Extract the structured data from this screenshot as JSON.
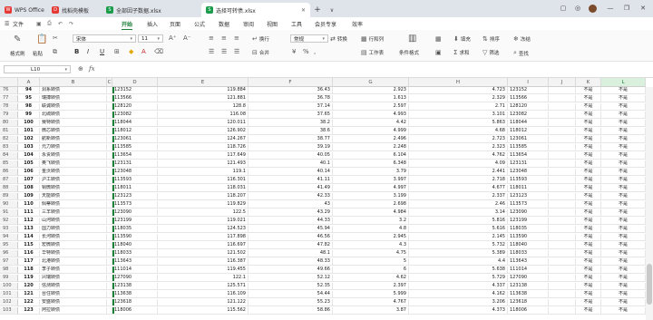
{
  "tabs": [
    {
      "label": "WPS Office",
      "icon": "wps-logo-icon",
      "color": "#e53935"
    },
    {
      "label": "找稻壳模板",
      "icon": "template-icon",
      "color": "#e53935"
    },
    {
      "label": "全部因子数据.xlsx",
      "icon": "excel-file-icon",
      "color": "#1a9c4a"
    },
    {
      "label": "选择可转债.xlsx",
      "icon": "excel-file-icon",
      "color": "#1a9c4a"
    }
  ],
  "menu": {
    "file": "文件",
    "items": [
      "开始",
      "插入",
      "页面",
      "公式",
      "数据",
      "审阅",
      "视图",
      "工具",
      "会员专享",
      "效率"
    ],
    "active": "开始"
  },
  "ribbon": {
    "format_painter": "格式刷",
    "paste": "粘贴",
    "font": "宋体",
    "font_size": "11",
    "wrap": "换行",
    "merge": "合并",
    "number_format": "常规",
    "convert": "转换",
    "rows_cols": "行和列",
    "worksheet": "工作表",
    "cond_format": "条件格式",
    "fill": "填充",
    "sort": "排序",
    "freeze": "冻结",
    "sum": "求和",
    "filter": "筛选",
    "find": "查找"
  },
  "formula": {
    "cell_ref": "L10",
    "fx": "fx",
    "value": ""
  },
  "columns": [
    "A",
    "B",
    "C",
    "D",
    "E",
    "F",
    "G",
    "H",
    "I",
    "J",
    "K",
    "L"
  ],
  "selected_column": "L",
  "rows": [
    [
      "76",
      "94",
      "洞系转债",
      "",
      "123152",
      "119.884",
      "36.43",
      "2.923",
      "4.723",
      "123152",
      "",
      "不是",
      "不是"
    ],
    [
      "77",
      "95",
      "瑞搏转债",
      "",
      "113566",
      "121.881",
      "36.78",
      "1.613",
      "2.329",
      "113566",
      "",
      "不是",
      "不是"
    ],
    [
      "78",
      "98",
      "联诚转债",
      "",
      "128120",
      "128.8",
      "37.14",
      "2.597",
      "2.71",
      "128120",
      "",
      "不是",
      "不是"
    ],
    [
      "79",
      "99",
      "北硫转债",
      "",
      "123082",
      "116.08",
      "37.65",
      "4.993",
      "3.101",
      "123082",
      "",
      "不是",
      "不是"
    ],
    [
      "80",
      "100",
      "赛特转债",
      "",
      "118044",
      "120.011",
      "38.2",
      "4.42",
      "5.863",
      "118044",
      "",
      "不是",
      "不是"
    ],
    [
      "81",
      "101",
      "微芯转债",
      "",
      "118012",
      "126.902",
      "38.6",
      "4.999",
      "4.68",
      "118012",
      "",
      "不是",
      "不是"
    ],
    [
      "82",
      "102",
      "航新转债",
      "",
      "123061",
      "124.267",
      "38.77",
      "2.496",
      "2.723",
      "123061",
      "",
      "不是",
      "不是"
    ],
    [
      "83",
      "103",
      "元力转债",
      "",
      "113585",
      "118.726",
      "39.19",
      "2.248",
      "2.323",
      "113585",
      "",
      "不是",
      "不是"
    ],
    [
      "84",
      "104",
      "永贵转债",
      "",
      "113654",
      "117.649",
      "40.05",
      "6.104",
      "4.762",
      "113654",
      "",
      "不是",
      "不是"
    ],
    [
      "85",
      "105",
      "奥飞转债",
      "",
      "123131",
      "121.493",
      "40.1",
      "6.348",
      "4.09",
      "123131",
      "",
      "不是",
      "不是"
    ],
    [
      "86",
      "106",
      "金沃转债",
      "",
      "123048",
      "119.1",
      "40.14",
      "3.79",
      "2.441",
      "123048",
      "",
      "不是",
      "不是"
    ],
    [
      "87",
      "107",
      "沪工转债",
      "",
      "113593",
      "116.301",
      "41.11",
      "3.997",
      "2.718",
      "113593",
      "",
      "不是",
      "不是"
    ],
    [
      "88",
      "108",
      "铜微转债",
      "",
      "118011",
      "118.031",
      "41.49",
      "4.997",
      "4.677",
      "118011",
      "",
      "不是",
      "不是"
    ],
    [
      "89",
      "109",
      "天能转债",
      "",
      "123123",
      "118.207",
      "42.33",
      "3.199",
      "2.337",
      "123123",
      "",
      "不是",
      "不是"
    ],
    [
      "90",
      "110",
      "佩蒂转债",
      "",
      "113573",
      "119.829",
      "43",
      "2.698",
      "2.46",
      "113573",
      "",
      "不是",
      "不是"
    ],
    [
      "91",
      "111",
      "三羊转债",
      "",
      "123090",
      "122.5",
      "43.29",
      "4.984",
      "3.14",
      "123090",
      "",
      "不是",
      "不是"
    ],
    [
      "92",
      "112",
      "山河转债",
      "",
      "123199",
      "119.021",
      "44.33",
      "3.2",
      "5.816",
      "123199",
      "",
      "不是",
      "不是"
    ],
    [
      "93",
      "113",
      "国力转债",
      "",
      "118035",
      "124.523",
      "45.94",
      "4.8",
      "5.616",
      "118035",
      "",
      "不是",
      "不是"
    ],
    [
      "94",
      "114",
      "长河转债",
      "",
      "113590",
      "117.898",
      "46.56",
      "2.945",
      "2.145",
      "113590",
      "",
      "不是",
      "不是"
    ],
    [
      "95",
      "115",
      "宏微转债",
      "",
      "118040",
      "116.697",
      "47.82",
      "4.3",
      "5.732",
      "118040",
      "",
      "不是",
      "不是"
    ],
    [
      "96",
      "116",
      "华特转债",
      "",
      "118033",
      "121.502",
      "48.1",
      "4.75",
      "5.389",
      "118033",
      "",
      "不是",
      "不是"
    ],
    [
      "97",
      "117",
      "北港转债",
      "",
      "113643",
      "116.387",
      "48.33",
      "5",
      "4.4",
      "113643",
      "",
      "不是",
      "不是"
    ],
    [
      "98",
      "118",
      "李子转债",
      "",
      "111014",
      "119.455",
      "49.66",
      "6",
      "5.638",
      "111014",
      "",
      "不是",
      "不是"
    ],
    [
      "99",
      "119",
      "兴瑞转债",
      "",
      "127090",
      "122.1",
      "52.12",
      "4.62",
      "5.729",
      "127090",
      "",
      "不是",
      "不是"
    ],
    [
      "100",
      "120",
      "信测转债",
      "",
      "123138",
      "125.571",
      "52.35",
      "2.397",
      "4.337",
      "123138",
      "",
      "不是",
      "不是"
    ],
    [
      "101",
      "121",
      "台住转债",
      "",
      "113638",
      "116.109",
      "54.44",
      "5.999",
      "4.162",
      "113638",
      "",
      "不是",
      "不是"
    ],
    [
      "102",
      "122",
      "安盛转债",
      "",
      "123618",
      "121.122",
      "55.23",
      "4.767",
      "3.206",
      "123618",
      "",
      "不是",
      "不是"
    ],
    [
      "103",
      "123",
      "阿拉转债",
      "",
      "118006",
      "115.562",
      "58.86",
      "3.87",
      "4.373",
      "118006",
      "",
      "不是",
      "不是"
    ]
  ]
}
